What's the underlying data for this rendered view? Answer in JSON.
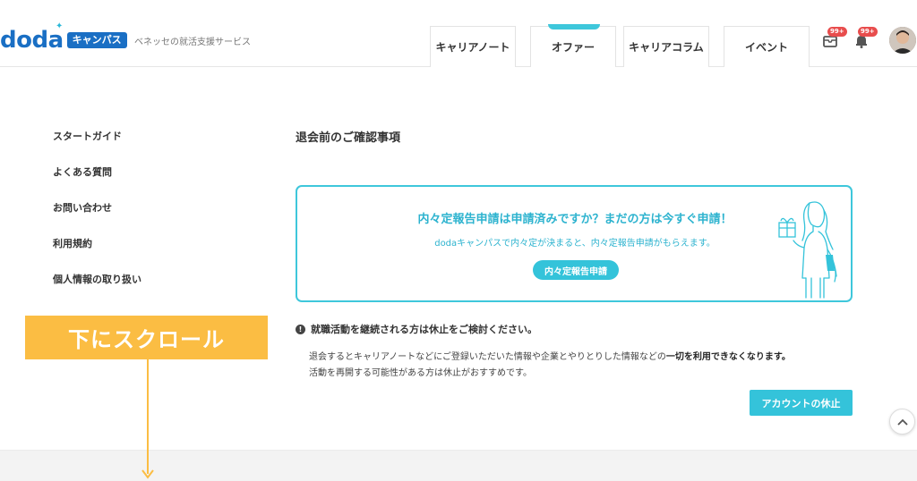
{
  "header": {
    "logo_text": "doda",
    "logo_badge": "キャンパス",
    "tagline": "ベネッセの就活支援サービス",
    "nav": [
      {
        "label": "キャリアノート"
      },
      {
        "label": "オファー"
      },
      {
        "label": "キャリアコラム"
      },
      {
        "label": "イベント"
      }
    ],
    "messages_badge": "99+",
    "notifications_badge": "99+",
    "icons": [
      "mail-icon",
      "bell-icon"
    ]
  },
  "sidebar": {
    "items": [
      {
        "label": "スタートガイド"
      },
      {
        "label": "よくある質問"
      },
      {
        "label": "お問い合わせ"
      },
      {
        "label": "利用規約"
      },
      {
        "label": "個人情報の取り扱い"
      }
    ]
  },
  "main": {
    "title": "退会前のご確認事項",
    "promo": {
      "title": "内々定報告申請は申請済みですか？まだの方は今すぐ申請！",
      "subtitle": "dodaキャンパスで内々定が決まると、内々定報告申請がもらえます。",
      "button_label": "内々定報告申請"
    },
    "notice": "就職活動を継続される方は休止をご検討ください。",
    "body_line1_pre": "退会するとキャリアノートなどにご登録いただいた情報や企業とやりとりした情報などの",
    "body_line1_strong": "一切を利用できなくなります。",
    "body_line2": "活動を再開する可能性がある方は休止がおすすめです。",
    "suspend_button": "アカウントの休止"
  },
  "overlay": {
    "scroll_label": "下にスクロール"
  },
  "colors": {
    "accent": "#34c3da",
    "brand": "#1a6fc4",
    "highlight": "#fbbd43",
    "badge": "#e84d4d"
  }
}
